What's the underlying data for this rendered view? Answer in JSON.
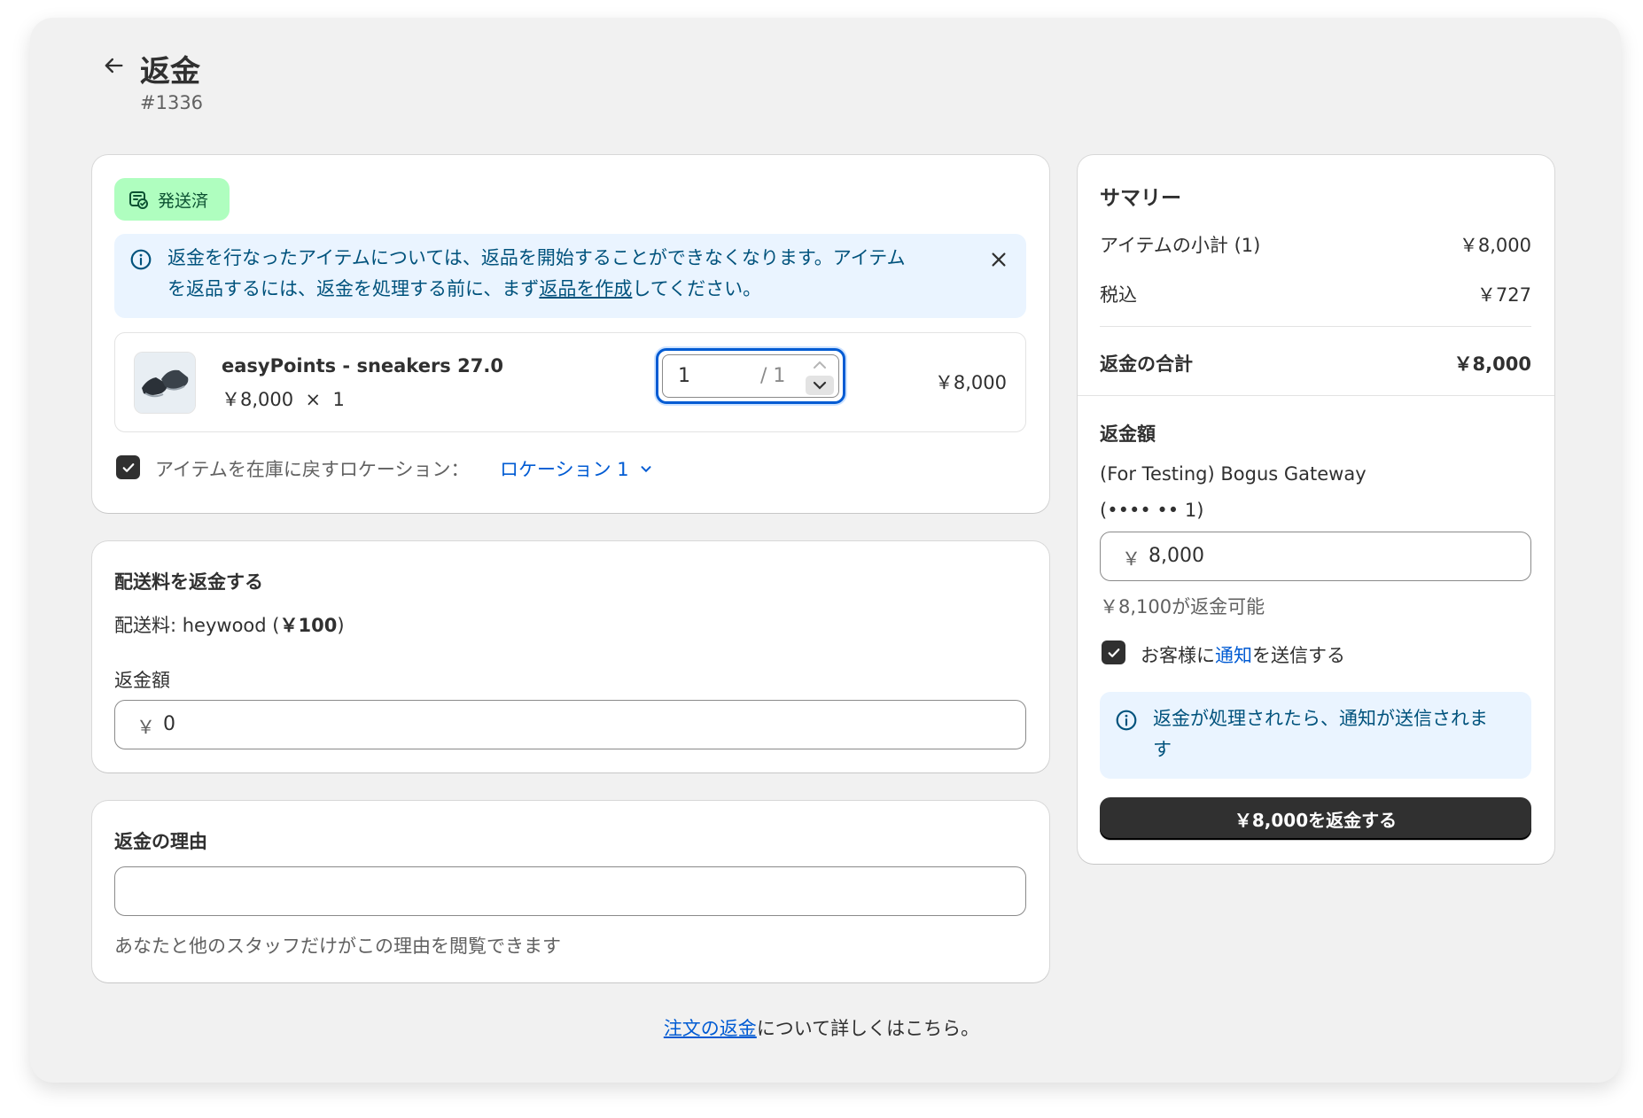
{
  "header": {
    "title": "返金",
    "order_number": "#1336"
  },
  "item_card": {
    "status_badge": "発送済",
    "banner": {
      "line1": "返金を行なったアイテムについては、返品を開始することができなくなります。アイテム",
      "line2_before": "を返品するには、返金を処理する前に、まず",
      "line2_link": "返品を作成",
      "line2_after": "してください。"
    },
    "product": {
      "name": "easyPoints - sneakers 27.0",
      "unit_price": "￥8,000",
      "times": "×",
      "quantity_ordered": "1",
      "qty_input_value": "1",
      "qty_of": "/ 1",
      "line_total": "￥8,000"
    },
    "restock": {
      "label": "アイテムを在庫に戻すロケーション：",
      "location": "ロケーション 1",
      "checked": true
    }
  },
  "shipping_card": {
    "title": "配送料を返金する",
    "shipping_label": "配送料: heywood (",
    "shipping_amount": "￥100",
    "shipping_close": ")",
    "refund_label": "返金額",
    "currency": "￥",
    "refund_value": "0"
  },
  "reason_card": {
    "title": "返金の理由",
    "input_value": "",
    "help_text": "あなたと他のスタッフだけがこの理由を閲覧できます"
  },
  "summary": {
    "title": "サマリー",
    "subtotal_label": "アイテムの小計 (1)",
    "subtotal_value": "￥8,000",
    "tax_label": "税込",
    "tax_value": "￥727",
    "total_label": "返金の合計",
    "total_value": "￥8,000",
    "refund_section_title": "返金額",
    "gateway_line1": "(For Testing) Bogus Gateway",
    "gateway_line2": "(•••• •• 1)",
    "currency": "￥",
    "refund_value": "8,000",
    "available_text": "￥8,100が返金可能",
    "notify_before": "お客様に",
    "notify_link": "通知",
    "notify_after": "を送信する",
    "notify_checked": true,
    "notify_banner_line1": "返金が処理されたら、通知が送信されま",
    "notify_banner_line2": "す",
    "refund_button": "￥8,000を返金する"
  },
  "footer": {
    "link": "注文の返金",
    "text": "について詳しくはこちら。"
  },
  "colors": {
    "accent": "#005bd3",
    "badge_bg": "#affebf",
    "banner_bg": "#eaf4ff",
    "primary_button": "#303030"
  }
}
